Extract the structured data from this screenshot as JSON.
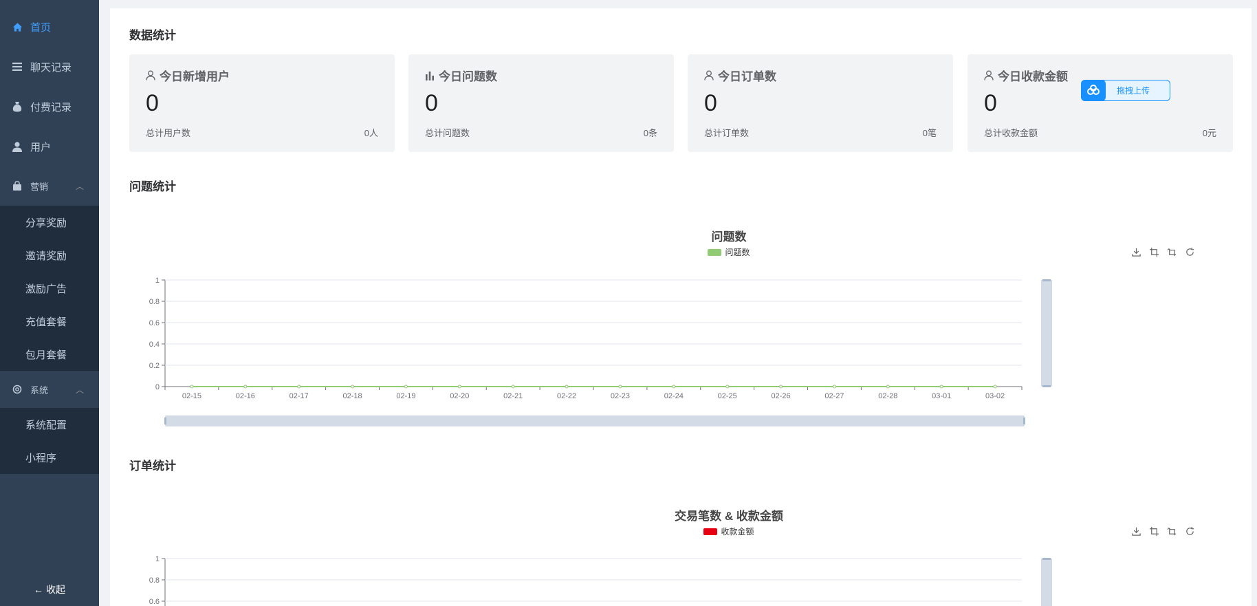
{
  "sidebar": {
    "home": "首页",
    "chat_records": "聊天记录",
    "payment_records": "付费记录",
    "users": "用户",
    "marketing": "营销",
    "marketing_items": [
      "分享奖励",
      "邀请奖励",
      "激励广告",
      "充值套餐",
      "包月套餐"
    ],
    "system": "系统",
    "system_items": [
      "系统配置",
      "小程序"
    ],
    "collapse": "收起"
  },
  "sections": {
    "data_stats": "数据统计",
    "question_stats": "问题统计",
    "order_stats": "订单统计"
  },
  "cards": [
    {
      "title": "今日新增用户",
      "value": "0",
      "sub_label": "总计用户数",
      "sub_value": "0人"
    },
    {
      "title": "今日问题数",
      "value": "0",
      "sub_label": "总计问题数",
      "sub_value": "0条"
    },
    {
      "title": "今日订单数",
      "value": "0",
      "sub_label": "总计订单数",
      "sub_value": "0笔"
    },
    {
      "title": "今日收款金额",
      "value": "0",
      "sub_label": "总计收款金额",
      "sub_value": "0元"
    }
  ],
  "upload_widget": {
    "label": "拖拽上传"
  },
  "colors": {
    "sidebar_bg": "#304156",
    "submenu_bg": "#1f2d3d",
    "active": "#409eff",
    "question_series": "#91cc75",
    "revenue_series": "#e60012"
  },
  "chart_data": [
    {
      "type": "line",
      "title": "问题数",
      "series": [
        {
          "name": "问题数",
          "values": [
            0,
            0,
            0,
            0,
            0,
            0,
            0,
            0,
            0,
            0,
            0,
            0,
            0,
            0,
            0,
            0
          ]
        }
      ],
      "x": [
        "02-15",
        "02-16",
        "02-17",
        "02-18",
        "02-19",
        "02-20",
        "02-21",
        "02-22",
        "02-23",
        "02-24",
        "02-25",
        "02-26",
        "02-27",
        "02-28",
        "03-01",
        "03-02"
      ],
      "yticks": [
        "0",
        "0.2",
        "0.4",
        "0.6",
        "0.8",
        "1"
      ],
      "ylim": [
        0,
        1
      ],
      "legend": "top-center",
      "grid": true
    },
    {
      "type": "line",
      "title": "交易笔数 & 收款金额",
      "series": [
        {
          "name": "收款金额",
          "values": []
        }
      ],
      "yticks": [
        "0.6",
        "0.8",
        "1"
      ],
      "ylim": [
        0,
        1
      ],
      "legend": "top-center",
      "grid": true
    }
  ]
}
